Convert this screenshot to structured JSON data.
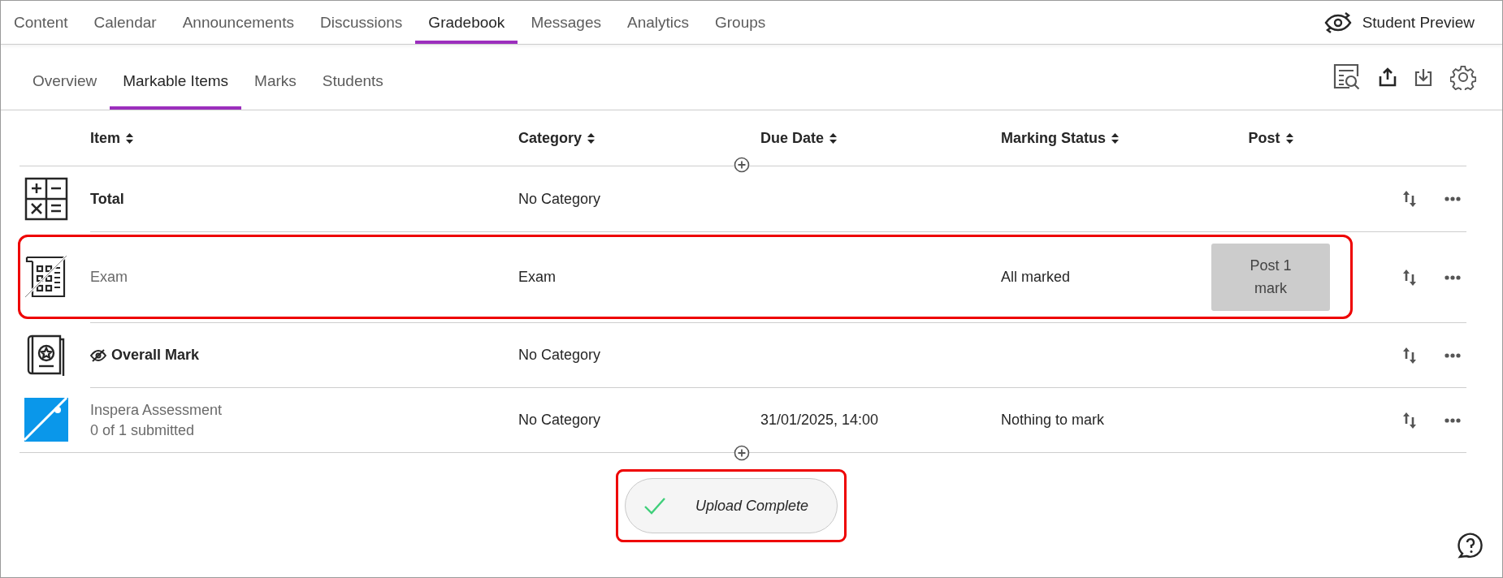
{
  "course_nav": {
    "tabs": [
      {
        "label": "Content",
        "selected": false
      },
      {
        "label": "Calendar",
        "selected": false
      },
      {
        "label": "Announcements",
        "selected": false
      },
      {
        "label": "Discussions",
        "selected": false
      },
      {
        "label": "Gradebook",
        "selected": true
      },
      {
        "label": "Messages",
        "selected": false
      },
      {
        "label": "Analytics",
        "selected": false
      },
      {
        "label": "Groups",
        "selected": false
      }
    ],
    "student_preview": "Student Preview"
  },
  "gradebook_tabs": [
    {
      "label": "Overview",
      "selected": false
    },
    {
      "label": "Markable Items",
      "selected": true
    },
    {
      "label": "Marks",
      "selected": false
    },
    {
      "label": "Students",
      "selected": false
    }
  ],
  "table": {
    "columns": [
      "Item",
      "Category",
      "Due Date",
      "Marking Status",
      "Post"
    ],
    "rows": [
      {
        "kind": "total",
        "name": "Total",
        "muted": false,
        "hidden_from_students": false,
        "highlighted": false,
        "category": "No Category"
      },
      {
        "kind": "exam",
        "name": "Exam",
        "muted": true,
        "hidden_from_students": false,
        "highlighted": true,
        "category": "Exam",
        "status": "All marked",
        "post_button": "Post 1 mark"
      },
      {
        "kind": "overall",
        "name": "Overall Mark",
        "muted": false,
        "hidden_from_students": true,
        "highlighted": false,
        "category": "No Category"
      },
      {
        "kind": "external",
        "name": "Inspera Assessment",
        "subtitle": "0 of 1 submitted",
        "muted": true,
        "hidden_from_students": false,
        "highlighted": false,
        "category": "No Category",
        "due_date": "31/01/2025, 14:00",
        "status": "Nothing to mark"
      }
    ]
  },
  "toast": {
    "message": "Upload Complete",
    "highlighted": true
  }
}
